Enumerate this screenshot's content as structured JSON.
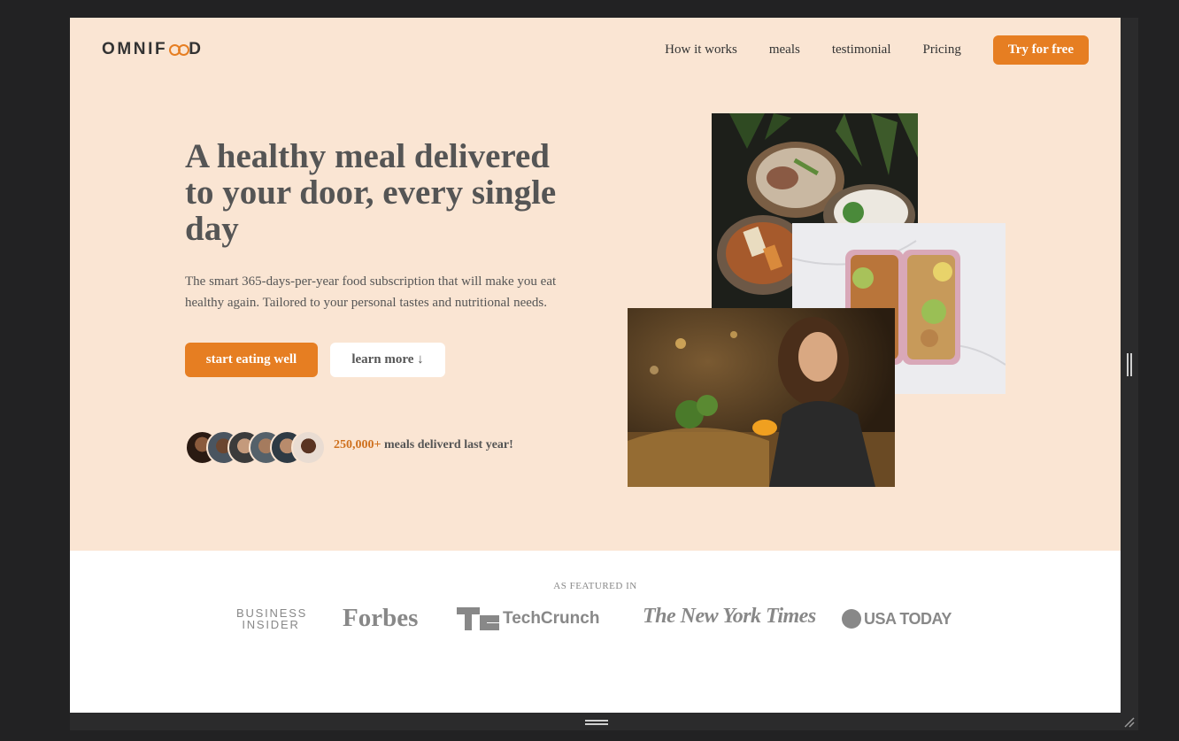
{
  "brand": {
    "logo_prefix": "OMNIF",
    "logo_suffix": "D"
  },
  "nav": {
    "items": [
      "How it works",
      "meals",
      "testimonial",
      "Pricing"
    ],
    "cta": "Try for free"
  },
  "hero": {
    "headline": "A healthy meal delivered to your door, every single day",
    "subtext": "The smart 365-days-per-year food subscription that will make you eat healthy again. Tailored to your personal tastes and nutritional needs.",
    "primary_button": "start eating well",
    "secondary_button": "learn more ↓",
    "delivered_count": "250,000+",
    "delivered_text": " meals deliverd last year!"
  },
  "featured": {
    "title": "AS FEATURED IN",
    "logos": [
      "BUSINESS INSIDER",
      "Forbes",
      "TechCrunch",
      "The New York Times",
      "USA TODAY"
    ]
  },
  "colors": {
    "accent": "#e67e22",
    "hero_bg": "#fae5d3",
    "text": "#555555"
  }
}
